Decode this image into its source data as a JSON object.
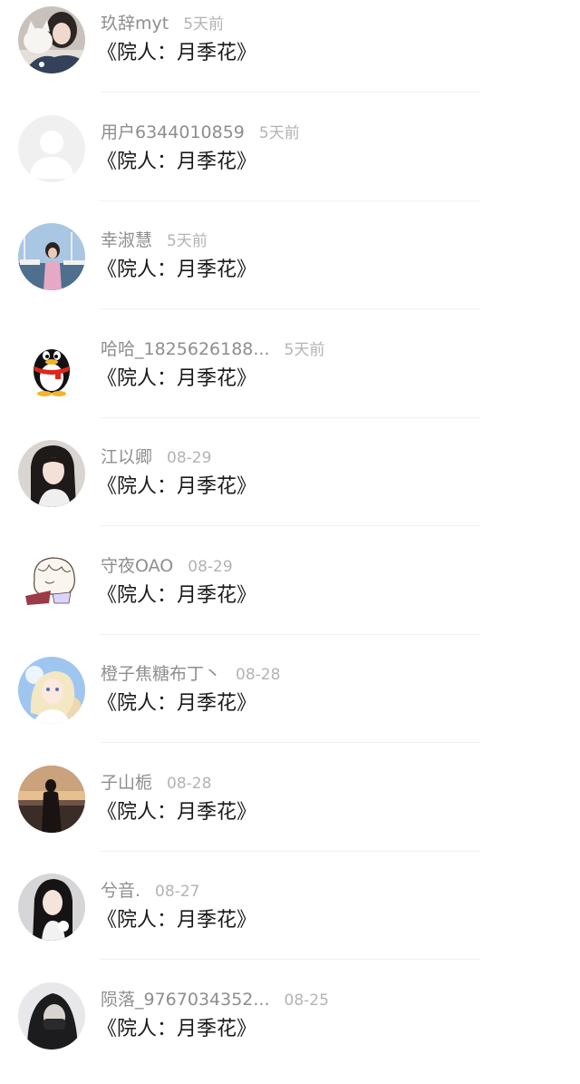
{
  "comments": [
    {
      "user": "玖辞myt",
      "time": "5天前",
      "text": "《院人：月季花》",
      "avatar": "avatar-girl-with-cat"
    },
    {
      "user": "用户6344010859",
      "time": "5天前",
      "text": "《院人：月季花》",
      "avatar": "default-user-avatar"
    },
    {
      "user": "幸淑慧",
      "time": "5天前",
      "text": "《院人：月季花》",
      "avatar": "avatar-girl-at-harbor"
    },
    {
      "user": "哈哈_1825626188...",
      "time": "5天前",
      "text": "《院人：月季花》",
      "avatar": "qq-penguin-avatar"
    },
    {
      "user": "江以卿",
      "time": "08-29",
      "text": "《院人：月季花》",
      "avatar": "avatar-girl-dark-hair"
    },
    {
      "user": "守夜OAO",
      "time": "08-29",
      "text": "《院人：月季花》",
      "avatar": "avatar-sketch-character"
    },
    {
      "user": "橙子焦糖布丁丶",
      "time": "08-28",
      "text": "《院人：月季花》",
      "avatar": "avatar-anime-girl"
    },
    {
      "user": "子山栀",
      "time": "08-28",
      "text": "《院人：月季花》",
      "avatar": "avatar-sunset-silhouette"
    },
    {
      "user": "兮音.",
      "time": "08-27",
      "text": "《院人：月季花》",
      "avatar": "avatar-girl-black-hair"
    },
    {
      "user": "陨落_9767034352...",
      "time": "08-25",
      "text": "《院人：月季花》",
      "avatar": "avatar-hooded-person"
    }
  ]
}
